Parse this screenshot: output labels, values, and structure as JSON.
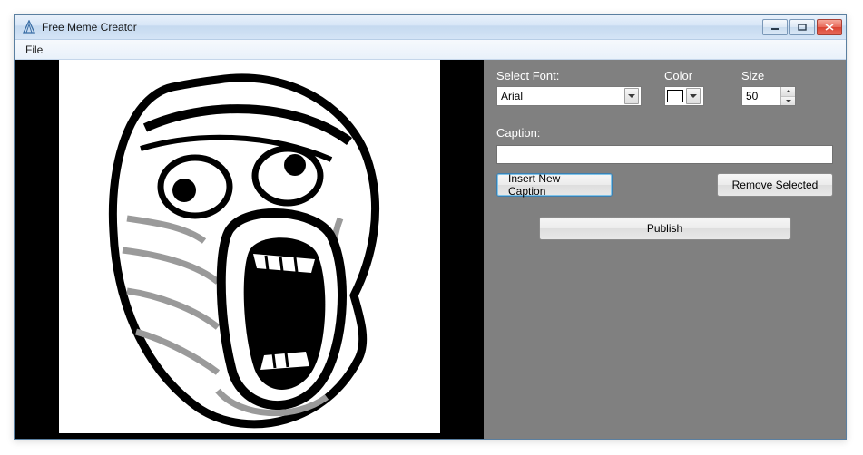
{
  "window": {
    "title": "Free Meme Creator"
  },
  "menu": {
    "file": "File"
  },
  "panel": {
    "font_label": "Select Font:",
    "font_value": "Arial",
    "color_label": "Color",
    "color_value": "#ffffff",
    "size_label": "Size",
    "size_value": "50",
    "caption_label": "Caption:",
    "caption_value": "",
    "insert_label": "Insert New Caption",
    "remove_label": "Remove Selected",
    "publish_label": "Publish"
  }
}
